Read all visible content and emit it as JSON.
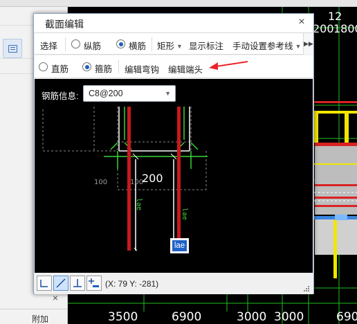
{
  "dialog": {
    "title": "截面编辑",
    "close_glyph": "×"
  },
  "toolbar1": {
    "select_label": "选择",
    "radio_longitudinal": "纵筋",
    "radio_transverse": "横筋",
    "transverse_checked": true,
    "shape_dropdown": "矩形",
    "show_annotation": "显示标注",
    "manual_reference": "手动设置参考线"
  },
  "toolbar2": {
    "radio_straight": "直筋",
    "radio_stirrup": "箍筋",
    "stirrup_checked": true,
    "edit_hook": "编辑弯钩",
    "edit_end": "编辑端头"
  },
  "canvas": {
    "rebar_info_label": "钢筋信息:",
    "rebar_info_value": "C8@200",
    "dim_main": "200",
    "dim_small_left": "100",
    "dim_small_right": "100",
    "lae_left": "lae",
    "lae_right": "lae",
    "lae_tag": "lae"
  },
  "statusbar": {
    "coords": "(X: 79 Y: -281)"
  },
  "background": {
    "attach_label": "附加",
    "close_glyph": "×",
    "top_dims": [
      "12",
      "200",
      "1800"
    ],
    "bottom_dims": [
      "3500",
      "6900",
      "3000",
      "3000",
      "690"
    ]
  },
  "colors": {
    "rebar_red": "#c8191c",
    "stirrup_green": "#39d639",
    "accent_blue": "#1e62c8",
    "annotation_arrow": "#e8262b"
  }
}
